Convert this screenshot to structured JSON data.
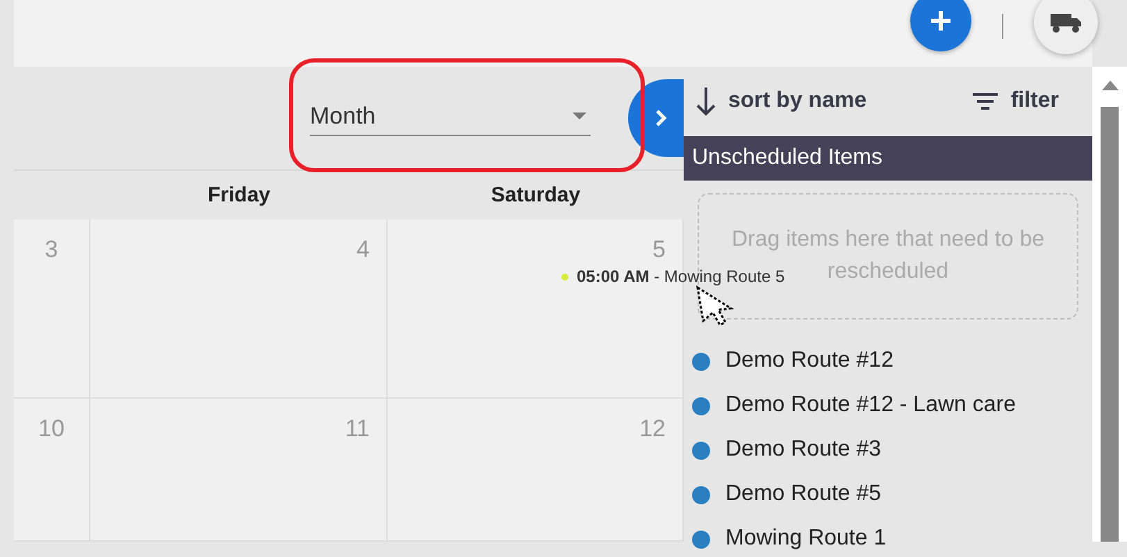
{
  "view_select": {
    "value": "Month"
  },
  "calendar": {
    "columns": [
      {
        "label": "Friday"
      },
      {
        "label": "Saturday"
      }
    ],
    "weeks": [
      {
        "days": [
          {
            "number": "3"
          },
          {
            "number": "4"
          },
          {
            "number": "5",
            "events": [
              {
                "text": "**05:00 AM** - Mowing Route 5",
                "color": "#d8ec3c"
              }
            ]
          }
        ]
      },
      {
        "days": [
          {
            "number": "10"
          },
          {
            "number": "11"
          },
          {
            "number": "12"
          }
        ]
      }
    ]
  },
  "sidebar": {
    "sort": "sort by name",
    "filter": "filter",
    "section": "Unscheduled Items",
    "dropzone": "Drag items here that need to be rescheduled",
    "items": [
      {
        "label": "Demo Route #12",
        "color": "#2a7fc0"
      },
      {
        "label": "Demo Route #12 - Lawn care",
        "color": "#2a7fc0"
      },
      {
        "label": "Demo Route #3",
        "color": "#2a7fc0"
      },
      {
        "label": "Demo Route #5",
        "color": "#2a7fc0"
      },
      {
        "label": "Mowing Route 1",
        "color": "#2a7fc0"
      }
    ]
  }
}
